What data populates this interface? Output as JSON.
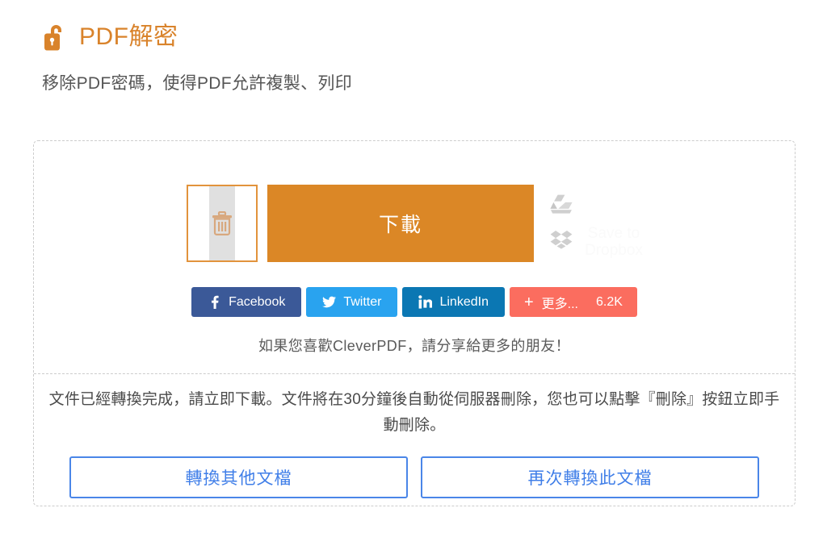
{
  "header": {
    "lock_icon": "open-padlock-icon",
    "title": "PDF解密",
    "subtitle": "移除PDF密碼，使得PDF允許複製、列印",
    "title_color": "#d9832b"
  },
  "actions": {
    "delete_icon": "trash-icon",
    "delete_label": "刪除",
    "download_label": "下載",
    "download_color": "#db8726",
    "cloud": {
      "gdrive_icon": "google-drive-icon",
      "dropbox_icon": "dropbox-icon",
      "dropbox_label": "Save to Dropbox"
    }
  },
  "share": {
    "buttons": [
      {
        "label": "Facebook",
        "icon": "facebook-icon",
        "color": "#3b5998"
      },
      {
        "label": "Twitter",
        "icon": "twitter-icon",
        "color": "#29a3ef"
      },
      {
        "label": "LinkedIn",
        "icon": "linkedin-icon",
        "color": "#0b77b3"
      }
    ],
    "more": {
      "plus": "+",
      "label": "更多...",
      "count": "6.2K",
      "color": "#fb6d5f"
    },
    "note": "如果您喜歡CleverPDF，請分享給更多的朋友！"
  },
  "status": {
    "message": "文件已經轉換完成，請立即下載。文件將在30分鐘後自動從伺服器刪除，您也可以點擊『刪除』按鈕立即手動刪除。"
  },
  "footer": {
    "convert_other_label": "轉換其他文檔",
    "convert_again_label": "再次轉換此文檔",
    "accent_color": "#4a86e8"
  }
}
